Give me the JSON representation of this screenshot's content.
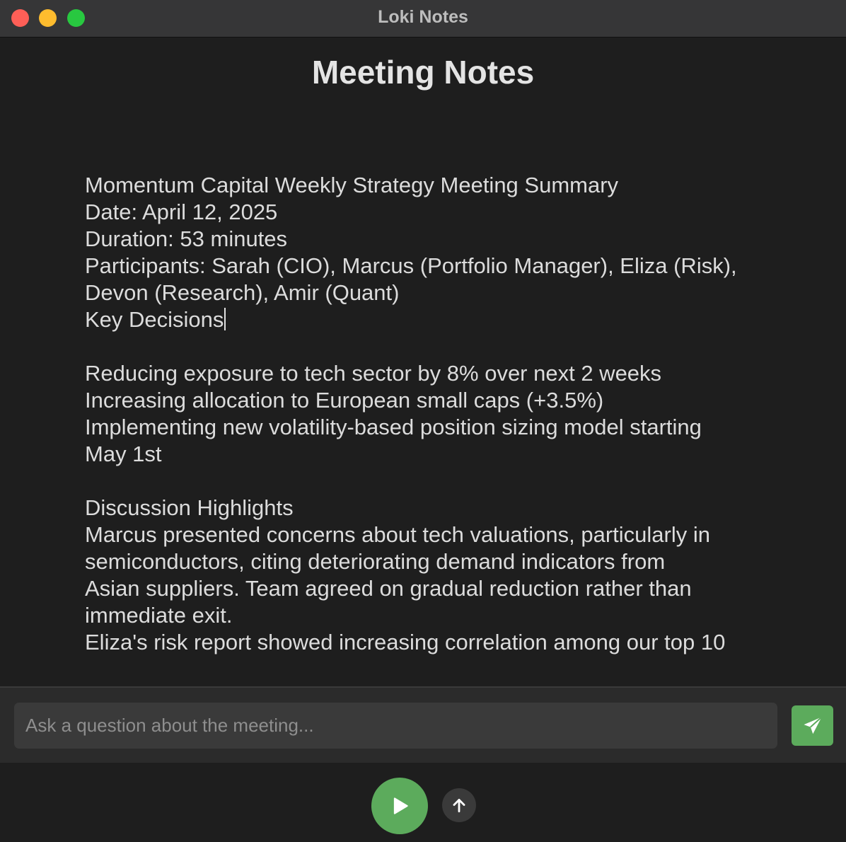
{
  "window": {
    "title": "Loki Notes"
  },
  "page": {
    "heading": "Meeting Notes"
  },
  "notes": {
    "lines": [
      "Momentum Capital Weekly Strategy Meeting Summary",
      "Date: April 12, 2025",
      "Duration: 53 minutes",
      "Participants: Sarah (CIO), Marcus (Portfolio Manager), Eliza (Risk),",
      "Devon (Research), Amir (Quant)",
      "Key Decisions",
      "",
      "Reducing exposure to tech sector by 8% over next 2 weeks",
      "Increasing allocation to European small caps (+3.5%)",
      "Implementing new volatility-based position sizing model starting",
      "May 1st",
      "",
      "Discussion Highlights",
      "Marcus presented concerns about tech valuations, particularly in",
      "semiconductors, citing deteriorating demand indicators from",
      "Asian suppliers. Team agreed on gradual reduction rather than",
      "immediate exit.",
      "Eliza's risk report showed increasing correlation among our top 10"
    ]
  },
  "chat": {
    "placeholder": "Ask a question about the meeting...",
    "value": ""
  },
  "icons": {
    "send": "paper-plane-icon",
    "play": "play-icon",
    "up": "arrow-up-icon"
  },
  "colors": {
    "accent": "#5cab5c",
    "background": "#1e1e1e",
    "titlebar": "#363637",
    "input_bg": "#3a3a3a"
  }
}
